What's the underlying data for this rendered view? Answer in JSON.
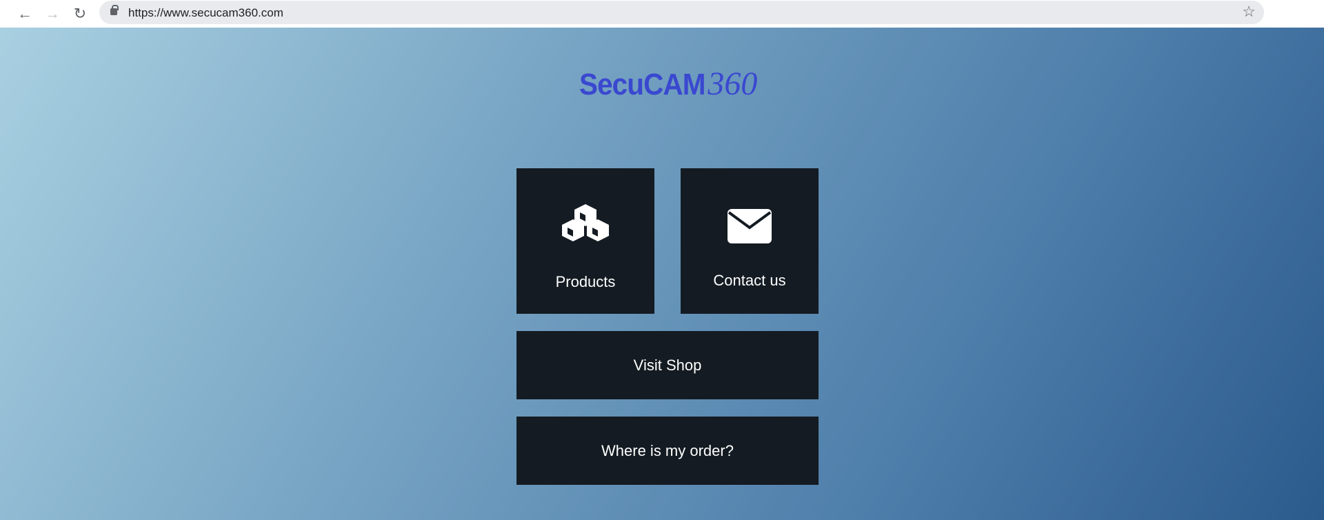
{
  "browser": {
    "url": "https://www.secucam360.com",
    "icons": [
      "back-icon",
      "forward-icon",
      "reload-icon",
      "lock-icon",
      "star-icon"
    ]
  },
  "logo": {
    "part1": "SecuCAM",
    "part2": "360",
    "color": "#3a48d0"
  },
  "tiles": {
    "products": "Products",
    "contact": "Contact us",
    "shop": "Visit Shop",
    "order": "Where is my order?"
  },
  "colors": {
    "tile_bg": "#141b22",
    "gradient_start": "#a9d0e1",
    "gradient_end": "#2b5a8d"
  }
}
